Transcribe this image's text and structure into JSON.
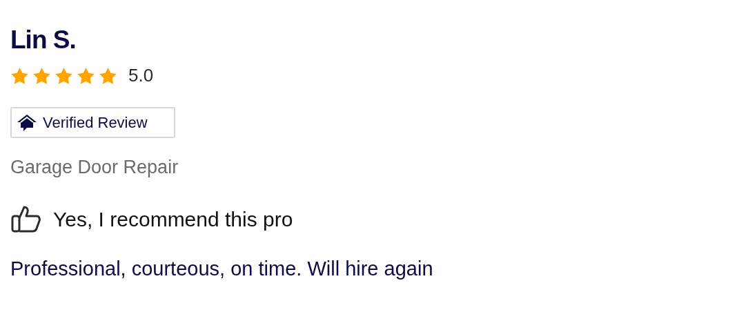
{
  "review": {
    "author": "Lin S.",
    "stars": 5,
    "rating": "5.0",
    "badge": "Verified Review",
    "category": "Garage Door Repair",
    "recommend": {
      "recommended": true,
      "label": "Yes, I recommend this pro"
    },
    "text": "Professional, courteous, on time. Will hire again"
  }
}
